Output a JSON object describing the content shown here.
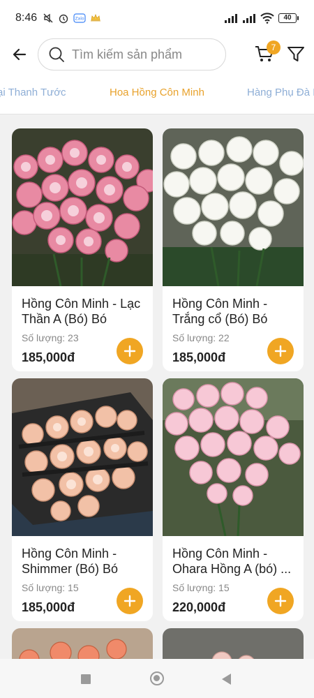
{
  "status_bar": {
    "time": "8:46",
    "battery": "40",
    "icons_left": [
      "mute-icon",
      "alarm-icon",
      "zalo-icon",
      "crown-icon"
    ],
    "icons_right": [
      "signal-icon",
      "signal-icon",
      "wifi-icon",
      "battery-icon"
    ]
  },
  "header": {
    "search_placeholder": "Tìm kiếm sản phẩm",
    "cart_count": "7"
  },
  "tabs": [
    {
      "label": "ại Thanh Tước",
      "active": false
    },
    {
      "label": "Hoa Hồng Côn Minh",
      "active": true
    },
    {
      "label": "Hàng Phụ Đà L",
      "active": false
    }
  ],
  "products": [
    {
      "title": "Hồng Côn Minh - Lạc Thần A (Bó) Bó",
      "quantity": "Số lượng: 23",
      "price": "185,000đ",
      "image": "pink-roses-bouquet"
    },
    {
      "title": "Hồng Côn Minh - Trắng cổ (Bó) Bó",
      "quantity": "Số lượng: 22",
      "price": "185,000đ",
      "image": "white-roses-bouquet"
    },
    {
      "title": "Hồng Côn Minh - Shimmer (Bó) Bó",
      "quantity": "Số lượng: 15",
      "price": "185,000đ",
      "image": "peach-roses-box"
    },
    {
      "title": "Hồng Côn Minh - Ohara Hồng A (bó) ...",
      "quantity": "Số lượng: 15",
      "price": "220,000đ",
      "image": "light-pink-roses-bouquet"
    }
  ],
  "colors": {
    "accent": "#f0a623",
    "tab_active": "#e8a22c",
    "tab_inactive": "#8eaed6"
  }
}
